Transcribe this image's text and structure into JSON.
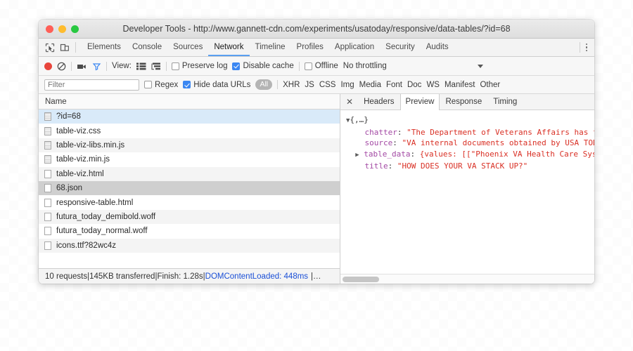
{
  "window": {
    "title": "Developer Tools - http://www.gannett-cdn.com/experiments/usatoday/responsive/data-tables/?id=68",
    "traffic_lights": [
      "close",
      "minimize",
      "zoom"
    ],
    "colors": {
      "close": "#ff5f57",
      "minimize": "#febc2e",
      "zoom": "#28c840",
      "accent_blue": "#5a9ff0",
      "checkbox_blue": "#3b87f2",
      "record_red": "#e8453c",
      "link_blue": "#1a4fd6",
      "json_key": "#a349a4",
      "json_value": "#d93025"
    }
  },
  "tabbar": {
    "icons": [
      "inspect-element-icon",
      "device-toolbar-icon"
    ],
    "tabs": [
      {
        "label": "Elements",
        "active": false
      },
      {
        "label": "Console",
        "active": false
      },
      {
        "label": "Sources",
        "active": false
      },
      {
        "label": "Network",
        "active": true
      },
      {
        "label": "Timeline",
        "active": false
      },
      {
        "label": "Profiles",
        "active": false
      },
      {
        "label": "Application",
        "active": false
      },
      {
        "label": "Security",
        "active": false
      },
      {
        "label": "Audits",
        "active": false
      }
    ],
    "menu_icon": "kebab-menu-icon"
  },
  "network_toolbar": {
    "record_icon": "record-icon",
    "clear_icon": "clear-icon",
    "capture_screenshots_icon": "camera-icon",
    "filter_icon": "funnel-icon",
    "view_label": "View:",
    "view_list_icon": "list-view-icon",
    "view_waterfall_icon": "waterfall-view-icon",
    "preserve_log": {
      "label": "Preserve log",
      "checked": false
    },
    "disable_cache": {
      "label": "Disable cache",
      "checked": true
    },
    "offline": {
      "label": "Offline",
      "checked": false
    },
    "throttling": {
      "value": "No throttling",
      "caret_icon": "chevron-down-icon"
    }
  },
  "filter_bar": {
    "input_placeholder": "Filter",
    "input_value": "",
    "regex": {
      "label": "Regex",
      "checked": false
    },
    "hide_data_urls": {
      "label": "Hide data URLs",
      "checked": true
    },
    "types": [
      {
        "label": "All",
        "active": true
      },
      {
        "label": "XHR",
        "active": false
      },
      {
        "label": "JS",
        "active": false
      },
      {
        "label": "CSS",
        "active": false
      },
      {
        "label": "Img",
        "active": false
      },
      {
        "label": "Media",
        "active": false
      },
      {
        "label": "Font",
        "active": false
      },
      {
        "label": "Doc",
        "active": false
      },
      {
        "label": "WS",
        "active": false
      },
      {
        "label": "Manifest",
        "active": false
      },
      {
        "label": "Other",
        "active": false
      }
    ]
  },
  "request_list": {
    "column_header": "Name",
    "rows": [
      {
        "name": "?id=68",
        "icon": "document-lines-icon",
        "state": "selected"
      },
      {
        "name": "table-viz.css",
        "icon": "document-lines-icon",
        "state": "normal"
      },
      {
        "name": "table-viz-libs.min.js",
        "icon": "document-lines-icon",
        "state": "alt"
      },
      {
        "name": "table-viz.min.js",
        "icon": "document-lines-icon",
        "state": "normal"
      },
      {
        "name": "table-viz.html",
        "icon": "document-icon",
        "state": "alt"
      },
      {
        "name": "68.json",
        "icon": "document-icon",
        "state": "highlighted"
      },
      {
        "name": "responsive-table.html",
        "icon": "document-icon",
        "state": "normal"
      },
      {
        "name": "futura_today_demibold.woff",
        "icon": "document-icon",
        "state": "alt"
      },
      {
        "name": "futura_today_normal.woff",
        "icon": "document-icon",
        "state": "normal"
      },
      {
        "name": "icons.ttf?82wc4z",
        "icon": "document-icon",
        "state": "alt"
      }
    ]
  },
  "status_bar": {
    "requests": "10 requests",
    "transferred": "145KB transferred",
    "finish": "Finish: 1.28s",
    "dom_content_loaded": "DOMContentLoaded: 448ms",
    "trailing": "|…",
    "separator": " | "
  },
  "detail_panel": {
    "close_icon": "close-icon",
    "tabs": [
      {
        "label": "Headers",
        "active": false
      },
      {
        "label": "Preview",
        "active": true
      },
      {
        "label": "Response",
        "active": false
      },
      {
        "label": "Timing",
        "active": false
      }
    ],
    "preview": {
      "root_line": "{,…}",
      "root_triangle": "▼",
      "lines": [
        {
          "indent": 2,
          "triangle": "",
          "key": "chatter",
          "value": "\"The Department of Veterans Affairs has for"
        },
        {
          "indent": 2,
          "triangle": "",
          "key": "source",
          "value": "\"VA internal documents obtained by USA TODAY"
        },
        {
          "indent": 1,
          "triangle": "▶",
          "key": "table_data",
          "value": "{values: [[\"Phoenix VA Health Care Syste"
        },
        {
          "indent": 2,
          "triangle": "",
          "key": "title",
          "value": "\"HOW DOES YOUR VA STACK UP?\""
        }
      ]
    },
    "scrollbar": "horizontal-scrollbar"
  }
}
